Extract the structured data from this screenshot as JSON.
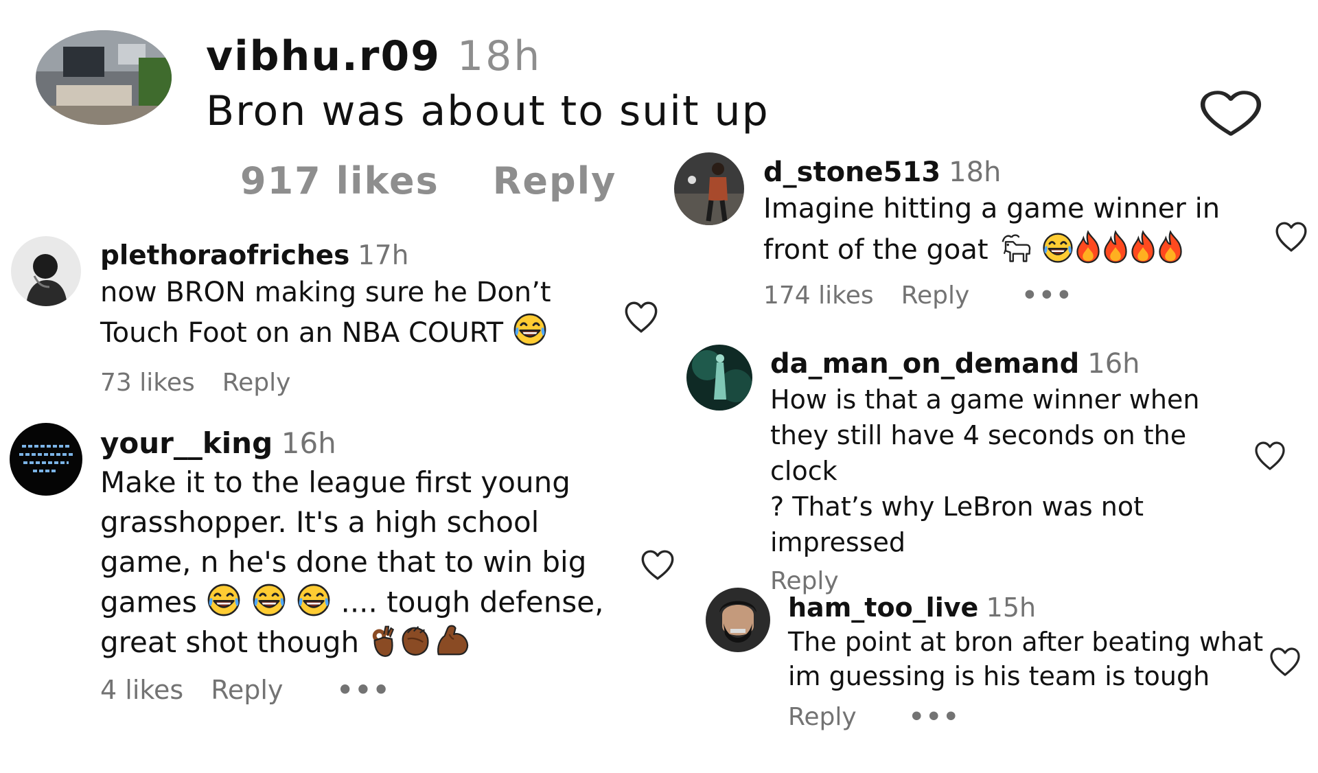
{
  "colors": {
    "text": "#111111",
    "secondary": "#737373",
    "background": "#ffffff"
  },
  "comments": [
    {
      "username": "vibhu.r09",
      "time": "18h",
      "text": "Bron was about to suit up",
      "likes": "917 likes",
      "reply": "Reply"
    },
    {
      "username": "plethoraofriches",
      "time": "17h",
      "text_lines": [
        "now BRON making sure he Don’t",
        "Touch Foot on an NBA COURT"
      ],
      "likes": "73 likes",
      "reply": "Reply"
    },
    {
      "username": "your__king",
      "time": "16h",
      "text_lines": [
        "Make it to the league first young",
        "grasshopper. It's a high school",
        "game, n he's done that to win big",
        "games",
        ".... tough defense,",
        "great shot though"
      ],
      "likes": "4 likes",
      "reply": "Reply",
      "more": "•••"
    },
    {
      "username": "d_stone513",
      "time": "18h",
      "text_lines": [
        "Imagine hitting a game winner in",
        "front of the goat"
      ],
      "likes": "174 likes",
      "reply": "Reply",
      "more": "•••"
    },
    {
      "username": "da_man_on_demand",
      "time": "16h",
      "text_lines": [
        "How is that a game winner when",
        "they still have 4 seconds on the clock",
        "? That’s why LeBron was not",
        "impressed"
      ],
      "reply": "Reply"
    },
    {
      "username": "ham_too_live",
      "time": "15h",
      "text_lines": [
        "The point at bron after beating what",
        "im guessing is his team is tough"
      ],
      "reply": "Reply",
      "more": "•••"
    }
  ],
  "icons": {
    "like": "heart-outline-icon",
    "laugh": "face-with-tears-of-joy-emoji",
    "fire": "fire-emoji",
    "goat": "goat-emoji",
    "ok": "ok-hand-emoji",
    "clap": "clapping-hands-emoji",
    "muscle": "flexed-biceps-emoji"
  }
}
